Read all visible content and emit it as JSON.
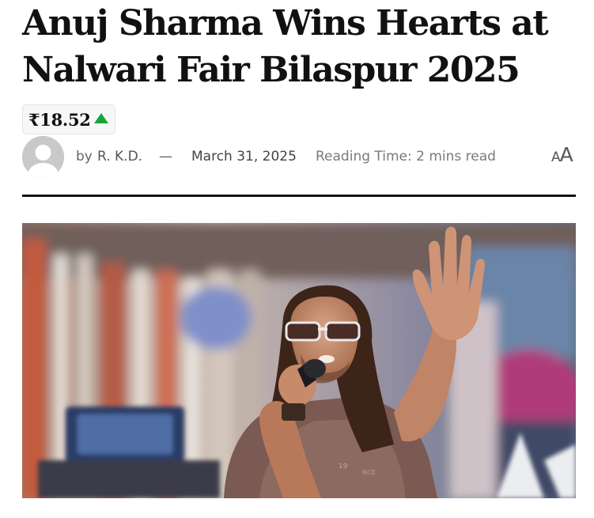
{
  "article": {
    "title": "Anuj Sharma Wins Hearts at Nalwari Fair Bilaspur 2025"
  },
  "stock": {
    "price": "₹18.52",
    "trend": "up",
    "trend_color": "#14a63a"
  },
  "meta": {
    "by_label": "by",
    "author": "R. K.D.",
    "separator": "—",
    "date": "March 31, 2025",
    "reading_time": "Reading Time: 2 mins read"
  },
  "font_toggle": {
    "small_label": "A",
    "large_label": "A"
  },
  "icons": {
    "avatar": "user-avatar-placeholder-icon",
    "trend": "triangle-up-icon"
  },
  "hero_image": {
    "alt": "Singer on stage holding a microphone and waving"
  }
}
